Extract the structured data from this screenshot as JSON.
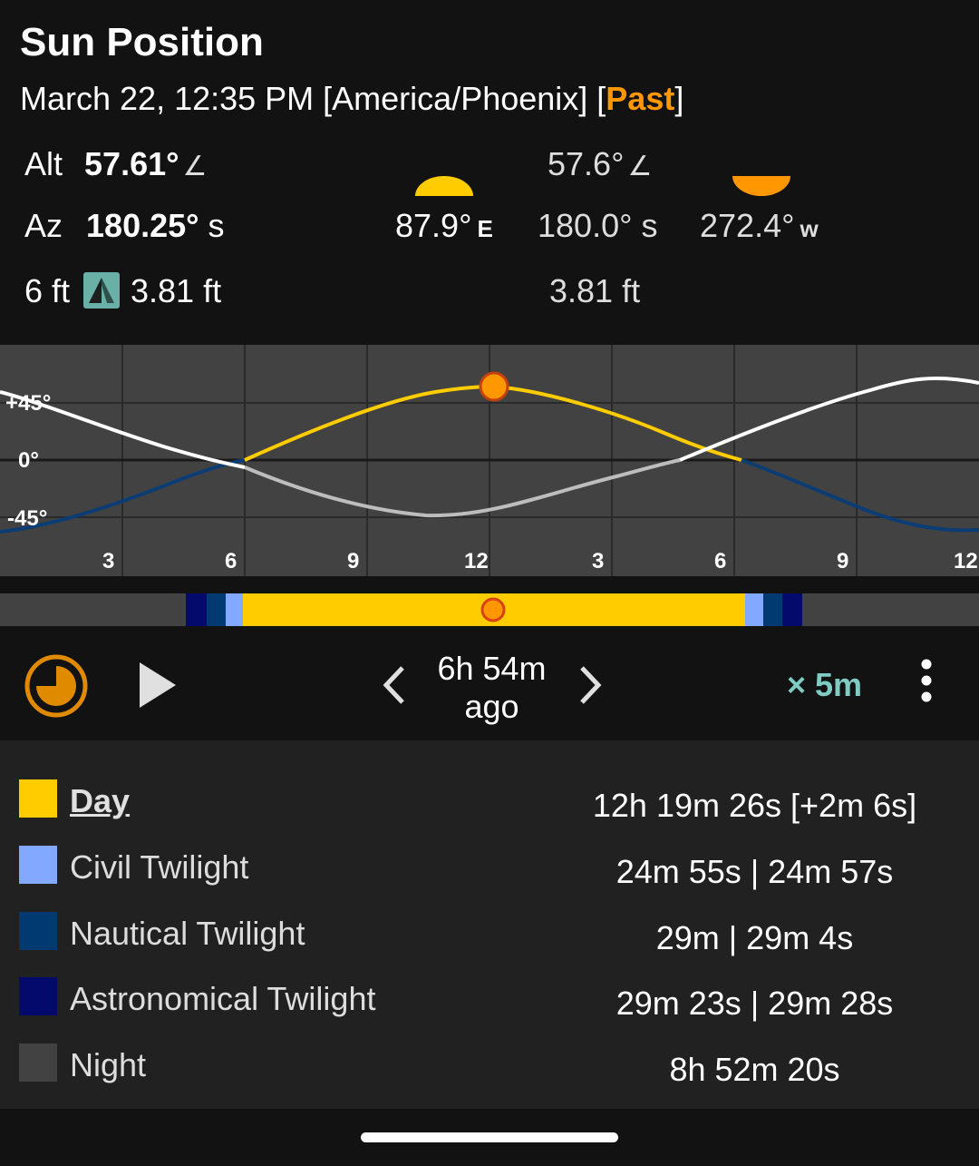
{
  "header": {
    "title": "Sun Position",
    "datetime": "March 22, 12:35 PM [America/Phoenix] [",
    "mode": "Past",
    "mode_close": "]"
  },
  "current": {
    "alt_label": "Alt",
    "alt_value": "57.61°",
    "az_label": "Az",
    "az_value": "180.25°",
    "az_dir": "s",
    "object_height": "6 ft",
    "shadow_length": "3.81 ft"
  },
  "sunrise": {
    "az_value": "87.9°",
    "az_dir": "E"
  },
  "noon": {
    "alt_value": "57.6°",
    "az_value": "180.0°",
    "az_dir": "s",
    "shadow_length": "3.81 ft"
  },
  "sunset": {
    "az_value": "272.4°",
    "az_dir": "w"
  },
  "angle_symbol": "∠",
  "chart": {
    "y_ticks": [
      "+45°",
      "0°",
      "-45°"
    ],
    "x_ticks": [
      "3",
      "6",
      "9",
      "12",
      "3",
      "6",
      "9",
      "12"
    ]
  },
  "controls": {
    "time_delta_line1": "6h 54m",
    "time_delta_line2": "ago",
    "speed": "× 5m"
  },
  "legend": [
    {
      "label": "Day",
      "value": "12h 19m 26s [+2m 6s]",
      "color": "#ffcc00"
    },
    {
      "label": "Civil Twilight",
      "value": "24m 55s | 24m 57s",
      "color": "#82a9ff"
    },
    {
      "label": "Nautical Twilight",
      "value": "29m | 29m 4s",
      "color": "#003a70"
    },
    {
      "label": "Astronomical Twilight",
      "value": "29m 23s | 29m 28s",
      "color": "#030a6b"
    },
    {
      "label": "Night",
      "value": "8h 52m 20s",
      "color": "#424242"
    }
  ],
  "colors": {
    "accent": "#ff9800",
    "day": "#ffcc00",
    "speed": "#80cbc4"
  },
  "icons": [
    "angle-icon",
    "shadow-icon",
    "sunrise-icon",
    "sunset-icon",
    "clock-icon",
    "play-icon",
    "chevron-left-icon",
    "chevron-right-icon",
    "overflow-menu-icon"
  ]
}
